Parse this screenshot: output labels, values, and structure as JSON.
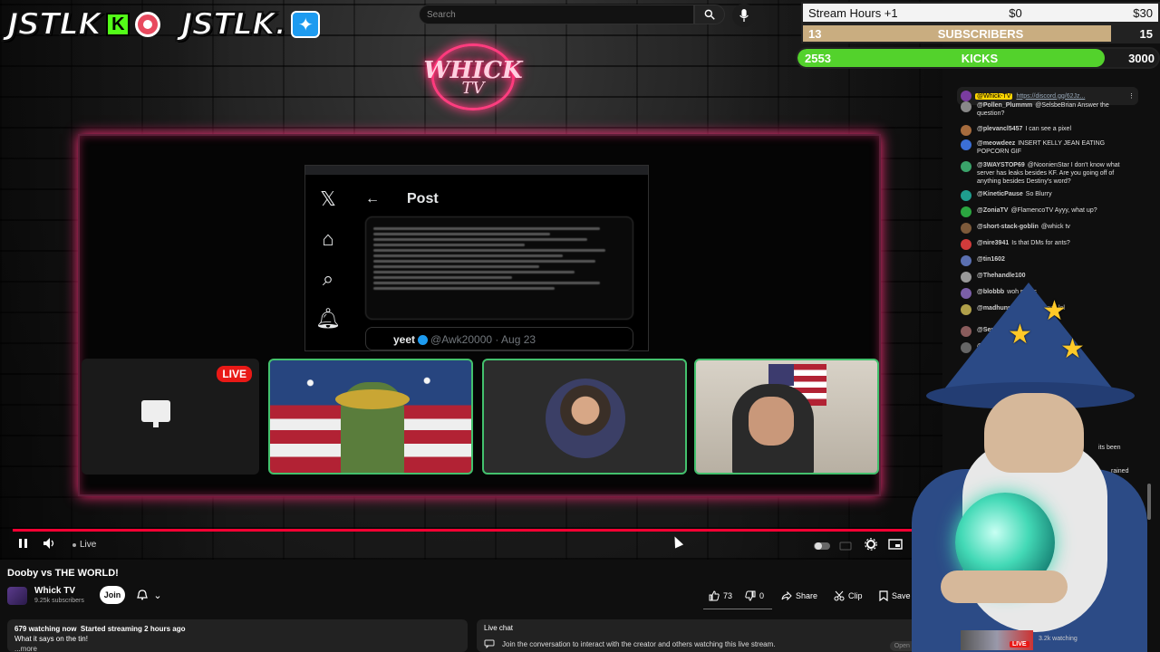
{
  "overlay": {
    "logo_left": "JSTLK",
    "logo_right": "JSTLK.",
    "neon_logo_line1": "WHICK",
    "neon_logo_line2": "TV",
    "stream_hours_label": "Stream Hours +1",
    "stream_hours_mid": "$0",
    "stream_hours_goal": "$30",
    "subscribers_current": "13",
    "subscribers_label": "SUBSCRIBERS",
    "subscribers_goal": "15",
    "subscribers_progress": 0.867,
    "kicks_current": "2553",
    "kicks_label": "KICKS",
    "kicks_goal": "3000",
    "kicks_progress": 0.851,
    "live_badge": "LIVE"
  },
  "search": {
    "placeholder": "Search"
  },
  "x_post": {
    "header": "Post",
    "author": "yeet",
    "handle_time": "@Awk20000 · Aug 23"
  },
  "player": {
    "live_label": "Live"
  },
  "video": {
    "title": "Dooby vs THE WORLD!",
    "channel_name": "Whick TV",
    "channel_subs": "9.25k subscribers",
    "join_label": "Join",
    "likes": "73",
    "dislikes": "0",
    "share_label": "Share",
    "clip_label": "Clip",
    "save_label": "Save",
    "watching": "679 watching now",
    "started": "Started streaming 2 hours ago",
    "description": "What it says on the tin!",
    "more": "...more"
  },
  "live_chat": {
    "heading": "Live chat",
    "prompt": "Join the conversation to interact with the creator and others watching this live stream.",
    "open_panel": "Open panel",
    "pinned_author": "@Whick-TV",
    "pinned_link": "https://discord.gg/62Jz...",
    "messages": [
      {
        "author": "@Pollen_Plummm",
        "text": "@SelsbeBrian Answer the question?",
        "color": "#888"
      },
      {
        "author": "@plevancl5457",
        "text": "I can see a pixel",
        "color": "#a56b3d"
      },
      {
        "author": "@meowdeez",
        "text": "INSERT KELLY JEAN EATING POPCORN GIF",
        "color": "#3b6fd6"
      },
      {
        "author": "@3WAYSTOP69",
        "text": "@NoonienStar I don't know what server has leaks besides KF. Are you going off of anything besides Destiny's word?",
        "color": "#3aa36a"
      },
      {
        "author": "@KineticPause",
        "text": "So Blurry",
        "color": "#1f9e8f"
      },
      {
        "author": "@ZoniaTV",
        "text": "@FlamencoTV Ayyy, what up?",
        "color": "#2ba640"
      },
      {
        "author": "@short-stack-goblin",
        "text": "@whick tv",
        "color": "#7d5a3a"
      },
      {
        "author": "@nire3941",
        "text": "Is that DMs for ants?",
        "color": "#d13b3b"
      },
      {
        "author": "@tin1602",
        "text": "",
        "color": "#5a6fb0"
      },
      {
        "author": "@Thehandle100",
        "text": "",
        "color": "#999"
      },
      {
        "author": "@blobbb",
        "text": "woh pixels",
        "color": "#7b5fa8"
      },
      {
        "author": "@madhunnebe",
        "text": "its so small lol",
        "color": "#b0a04a"
      },
      {
        "author": "@Senpat",
        "text": "7",
        "color": "#8a5c5c"
      },
      {
        "author": "@Ov",
        "text": "",
        "color": "#666"
      }
    ],
    "partial_1": "oney",
    "partial_2": "its been",
    "partial_3": "rained"
  },
  "bottom_strip": {
    "live_badge": "LIVE",
    "watching": "3.2k watching"
  }
}
